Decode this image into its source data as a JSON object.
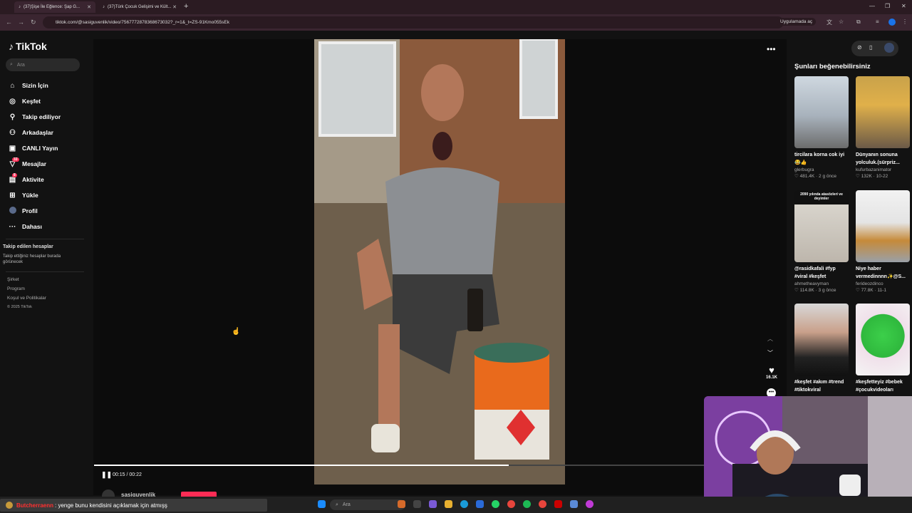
{
  "browser": {
    "tabs": [
      {
        "label": "(37)Şişe İle Eğlence: Şap G..."
      },
      {
        "label": "(37)Türk Çocuk Gelişimi ve Kült..."
      }
    ],
    "new_tab": "+",
    "url": "tiktok.com/@sasiguvenlik/video/7567772878368673032?_r=1&_t=ZS-91Kmo055sEk",
    "open_in_app": "Uygulamada aç"
  },
  "sidebar": {
    "logo": "TikTok",
    "search_placeholder": "Ara",
    "items": [
      {
        "label": "Sizin İçin",
        "icon": "home-icon"
      },
      {
        "label": "Keşfet",
        "icon": "compass-icon"
      },
      {
        "label": "Takip ediliyor",
        "icon": "following-icon"
      },
      {
        "label": "Arkadaşlar",
        "icon": "friends-icon"
      },
      {
        "label": "CANLI Yayın",
        "icon": "live-icon"
      },
      {
        "label": "Mesajlar",
        "icon": "message-icon",
        "badge": "33"
      },
      {
        "label": "Aktivite",
        "icon": "activity-icon",
        "badge": "8"
      },
      {
        "label": "Yükle",
        "icon": "upload-icon"
      },
      {
        "label": "Profil",
        "icon": "avatar-icon"
      },
      {
        "label": "Dahası",
        "icon": "more-icon"
      }
    ],
    "following_heading": "Takip edilen hesaplar",
    "following_text": "Takip ettiğiniz hesaplar burada görünecek",
    "footer": [
      "Şirket",
      "Program",
      "Koşul ve Politikalar",
      "© 2025 TikTok"
    ]
  },
  "player": {
    "time": "00:15 / 00:22",
    "progress": 0.68,
    "likes": "16.1K",
    "author": "sasiguvenlik"
  },
  "recommend": {
    "title": "Şunları beğenebilirsiniz",
    "cards": [
      {
        "title": "tircilara korna cok iyi 😂👍",
        "user": "glerbugra",
        "views": "481.4K",
        "date": "2 g önce"
      },
      {
        "title": "Dünyanın sonuna yolculuk.(sürpriz...",
        "user": "kufurbazanimator",
        "views": "132K",
        "date": "10-22"
      },
      {
        "title": "@rasidkafali #fyp #viral #keşfet",
        "user": "ahmetheavyman",
        "views": "114.8K",
        "date": "3 g önce"
      },
      {
        "title": "Niye haber vermedinnnn✨@S...",
        "user": "ferideozdinco",
        "views": "77.8K",
        "date": "11-1"
      },
      {
        "title": "#keşfet #akım #trend #tiktokviral",
        "user": "",
        "views": "",
        "date": ""
      },
      {
        "title": "#keşfetteyiz #bebek #çocukvideoları",
        "user": "",
        "views": "",
        "date": ""
      }
    ],
    "thumb_caption": "2090 yılında atasözleri ve deyimler"
  },
  "chat": {
    "user": "Butcherraenn",
    "message": ": yenge bunu kendisini açıklamak için atmışş"
  },
  "taskbar": {
    "search": "Ara"
  }
}
